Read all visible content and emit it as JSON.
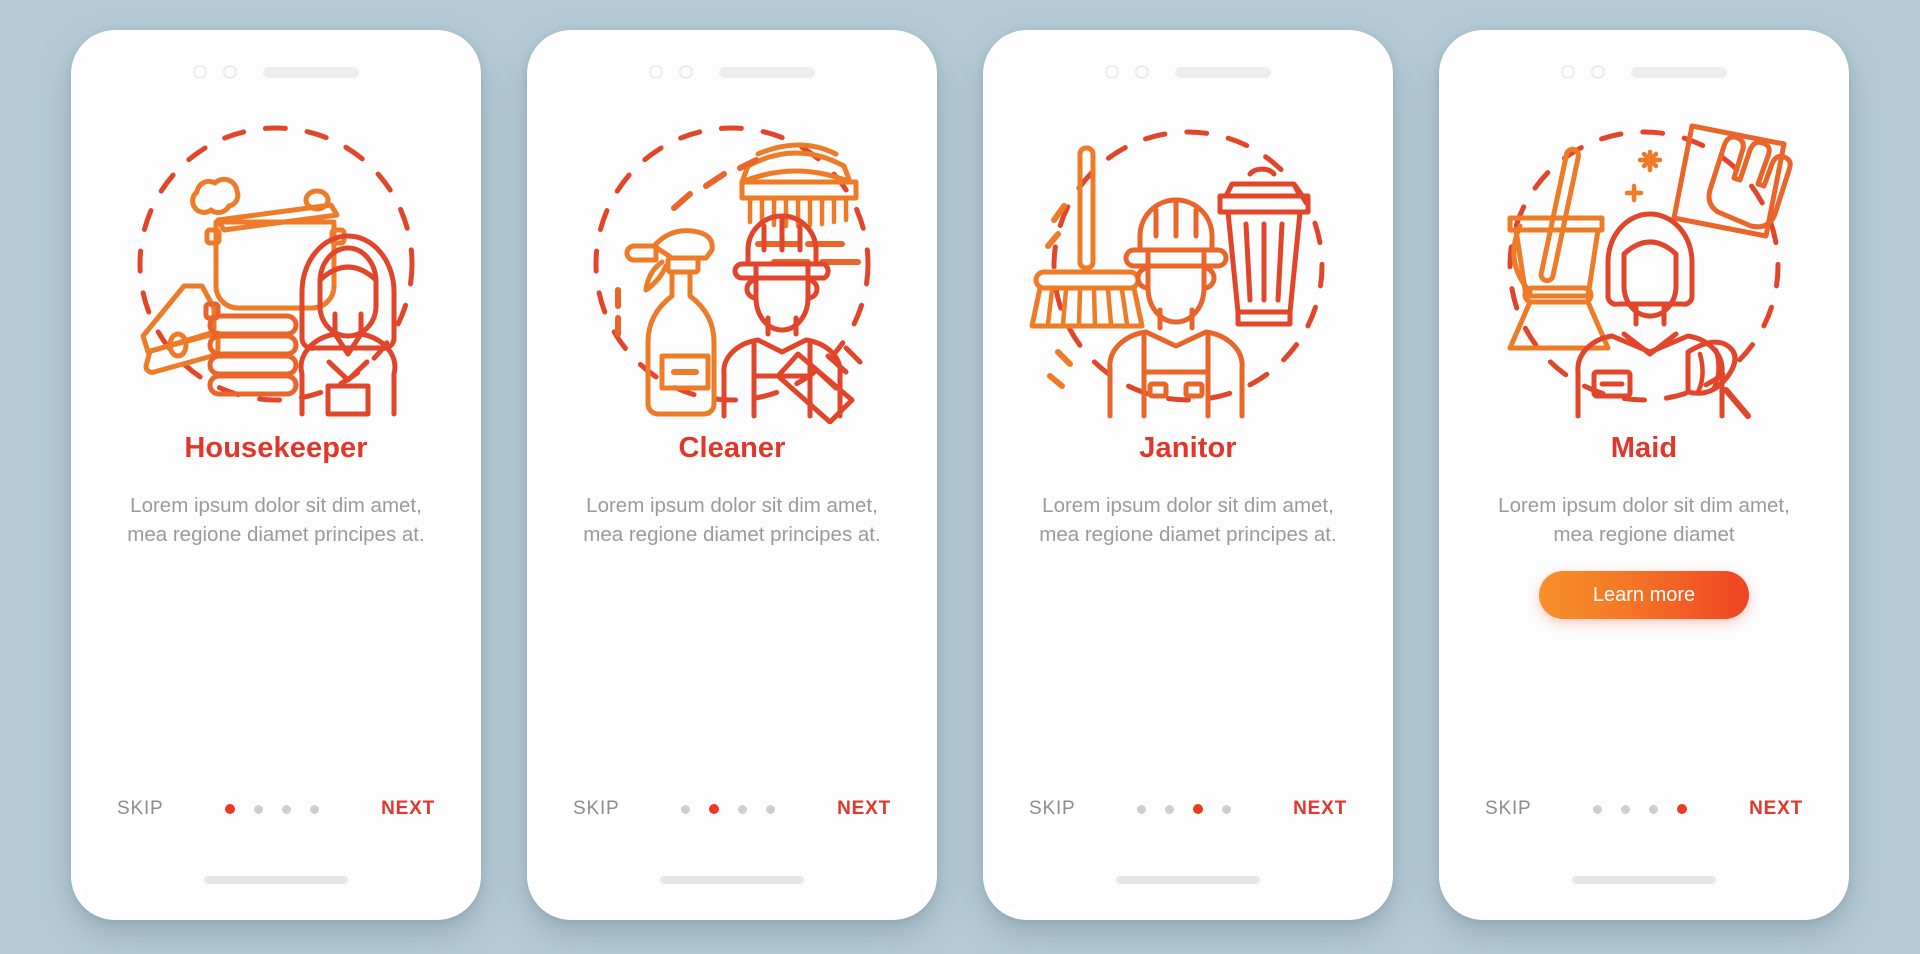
{
  "meta": {
    "background_color": "#b5ccd7",
    "accent_red": "#e1372a",
    "accent_orange": "#ef7f2a",
    "muted_text": "#9b9b9b",
    "dot_inactive": "#cfcfcf"
  },
  "screens": [
    {
      "id": "housekeeper",
      "title": "Housekeeper",
      "description": "Lorem ipsum dolor sit dim amet, mea regione diamet principes at.",
      "skip_label": "SKIP",
      "next_label": "NEXT",
      "active_dot": 0,
      "dot_count": 4,
      "cta": null,
      "illustration": "housekeeper-illustration"
    },
    {
      "id": "cleaner",
      "title": "Cleaner",
      "description": "Lorem ipsum dolor sit dim amet, mea regione diamet principes at.",
      "skip_label": "SKIP",
      "next_label": "NEXT",
      "active_dot": 1,
      "dot_count": 4,
      "cta": null,
      "illustration": "cleaner-illustration"
    },
    {
      "id": "janitor",
      "title": "Janitor",
      "description": "Lorem ipsum dolor sit dim amet, mea regione diamet principes at.",
      "skip_label": "SKIP",
      "next_label": "NEXT",
      "active_dot": 2,
      "dot_count": 4,
      "cta": null,
      "illustration": "janitor-illustration"
    },
    {
      "id": "maid",
      "title": "Maid",
      "description": "Lorem ipsum dolor sit dim amet, mea regione diamet",
      "skip_label": "SKIP",
      "next_label": "NEXT",
      "active_dot": 3,
      "dot_count": 4,
      "cta": "Learn more",
      "illustration": "maid-illustration"
    }
  ]
}
